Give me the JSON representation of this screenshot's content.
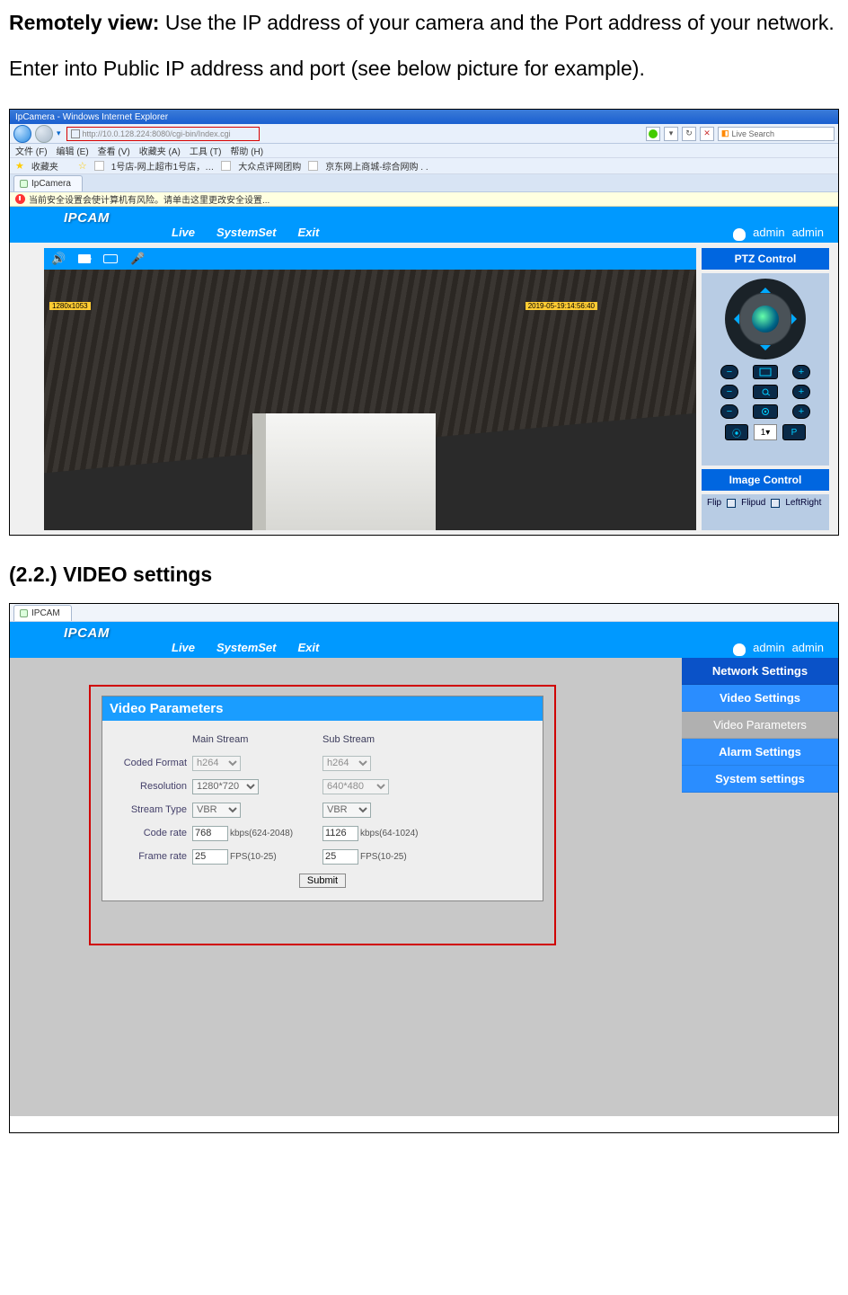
{
  "doc": {
    "remotely_bold": "Remotely view:",
    "para1_rest": " Use the IP address of your camera and the Port address of your network. Enter into Public IP address and port (see below picture for example).",
    "heading2": "(2.2.) VIDEO settings"
  },
  "ie": {
    "title": "IpCamera - Windows Internet Explorer",
    "url": "http://10.0.128.224:8080/cgi-bin/Index.cgi",
    "search_placeholder": "Live Search",
    "menu": [
      "文件 (F)",
      "编辑 (E)",
      "查看 (V)",
      "收藏夹 (A)",
      "工具 (T)",
      "帮助 (H)"
    ],
    "fav_label": "收藏夹",
    "fav_items": [
      "1号店-网上超市1号店，…",
      "大众点评网团购",
      "京东网上商城-综合网购 . ."
    ],
    "tab": "IpCamera",
    "security": "当前安全设置会使计算机有风险。请单击这里更改安全设置..."
  },
  "app": {
    "brand": "IPCAM",
    "nav": {
      "live": "Live",
      "systemset": "SystemSet",
      "exit": "Exit"
    },
    "user": {
      "name": "admin",
      "role": "admin"
    }
  },
  "live": {
    "ts_left": "1280x1053",
    "ts_right": "2019-05-19:14:56:40",
    "ptz_title": "PTZ Control",
    "imgctrl_title": "Image Control",
    "flip_label": "Flip",
    "flipud": "Flipud",
    "leftright": "LeftRight",
    "preset_value": "1"
  },
  "vs": {
    "tab": "IPCAM",
    "panel_title": "Video Parameters",
    "labels": {
      "main": "Main Stream",
      "sub": "Sub Stream",
      "coded": "Coded Format",
      "resolution": "Resolution",
      "streamtype": "Stream Type",
      "coderate": "Code rate",
      "framerate": "Frame rate"
    },
    "main": {
      "coded": "h264",
      "resolution": "1280*720",
      "streamtype": "VBR",
      "coderate": "768",
      "coderate_unit": "kbps(624-2048)",
      "framerate": "25",
      "framerate_unit": "FPS(10-25)"
    },
    "sub": {
      "coded": "h264",
      "resolution": "640*480",
      "streamtype": "VBR",
      "coderate": "1126",
      "coderate_unit": "kbps(64-1024)",
      "framerate": "25",
      "framerate_unit": "FPS(10-25)"
    },
    "submit": "Submit",
    "side": {
      "network": "Network Settings",
      "video": "Video Settings",
      "video_params": "Video Parameters",
      "alarm": "Alarm Settings",
      "system": "System settings"
    }
  }
}
